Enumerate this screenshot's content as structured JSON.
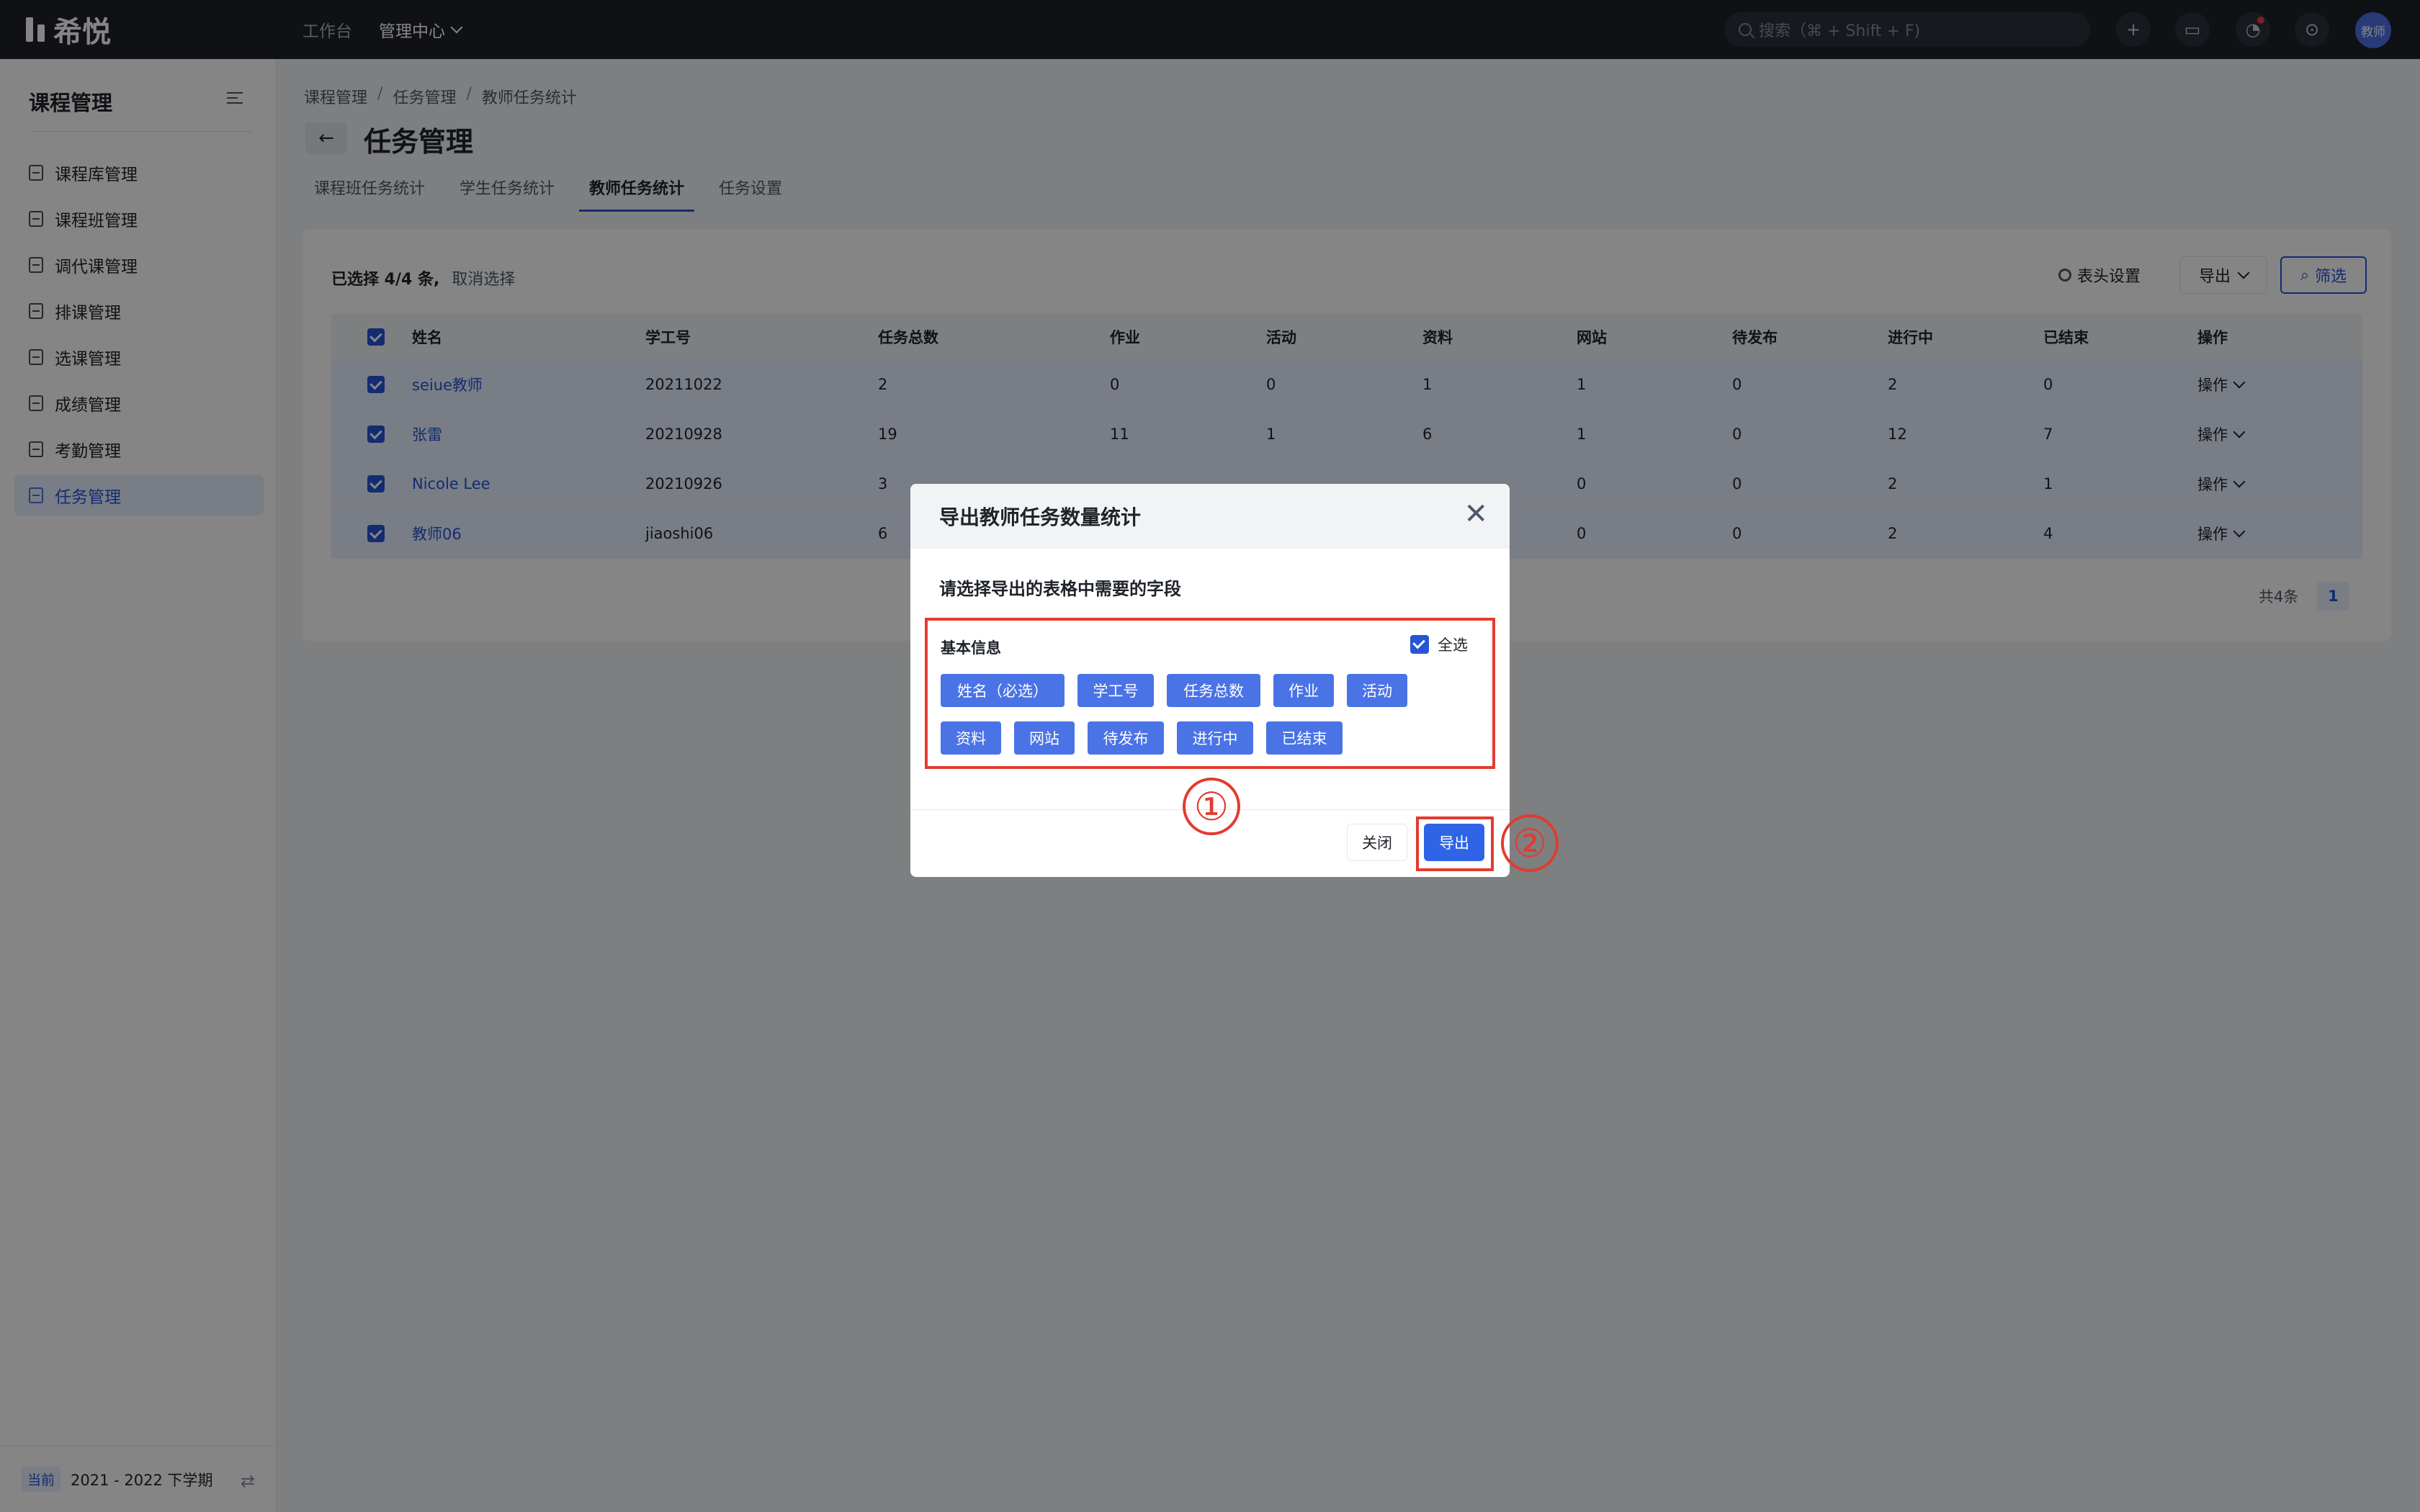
{
  "app": {
    "logo_text": "希悦"
  },
  "topbar": {
    "nav_work": "工作台",
    "nav_mgmt": "管理中心",
    "search_placeholder": "搜索（⌘ + Shift + F)",
    "avatar_text": "教师"
  },
  "sidebar": {
    "title": "课程管理",
    "items": [
      {
        "label": "课程库管理",
        "icon": "course-library-icon"
      },
      {
        "label": "课程班管理",
        "icon": "class-icon"
      },
      {
        "label": "调代课管理",
        "icon": "substitute-icon"
      },
      {
        "label": "排课管理",
        "icon": "schedule-icon"
      },
      {
        "label": "选课管理",
        "icon": "selection-icon"
      },
      {
        "label": "成绩管理",
        "icon": "grade-icon"
      },
      {
        "label": "考勤管理",
        "icon": "attendance-icon"
      },
      {
        "label": "任务管理",
        "icon": "task-list-icon",
        "active": true
      }
    ],
    "footer_badge": "当前",
    "footer_term": "2021 - 2022 下学期"
  },
  "breadcrumb": [
    "课程管理",
    "任务管理",
    "教师任务统计"
  ],
  "page": {
    "title": "任务管理"
  },
  "tabs": [
    "课程班任务统计",
    "学生任务统计",
    "教师任务统计",
    "任务设置"
  ],
  "active_tab": 2,
  "toolbar": {
    "selected_text": "已选择 4/4 条,",
    "cancel_select": "取消选择",
    "header_settings": "表头设置",
    "export_label": "导出",
    "filter_label": "筛选"
  },
  "table": {
    "columns": [
      "姓名",
      "学工号",
      "任务总数",
      "作业",
      "活动",
      "资料",
      "网站",
      "待发布",
      "进行中",
      "已结束",
      "操作"
    ],
    "rows": [
      [
        "seiue教师",
        "20211022",
        "2",
        "0",
        "0",
        "1",
        "1",
        "0",
        "2",
        "0",
        "操作"
      ],
      [
        "张雷",
        "20210928",
        "19",
        "11",
        "1",
        "6",
        "1",
        "0",
        "12",
        "7",
        "操作"
      ],
      [
        "Nicole Lee",
        "20210926",
        "3",
        "",
        "",
        "",
        "0",
        "0",
        "2",
        "1",
        "操作"
      ],
      [
        "教师06",
        "jiaoshi06",
        "6",
        "",
        "",
        "",
        "0",
        "0",
        "2",
        "4",
        "操作"
      ]
    ]
  },
  "pager": {
    "total": "共4条",
    "current": "1"
  },
  "modal": {
    "title": "导出教师任务数量统计",
    "subtitle": "请选择导出的表格中需要的字段",
    "group_label": "基本信息",
    "select_all": "全选",
    "fields": [
      "姓名（必选）",
      "学工号",
      "任务总数",
      "作业",
      "活动",
      "资料",
      "网站",
      "待发布",
      "进行中",
      "已结束"
    ],
    "close_label": "关闭",
    "export_label": "导出"
  },
  "annotations": {
    "marker1": "①",
    "marker2": "②"
  },
  "colors": {
    "accent": "#2655d8",
    "chip": "#4a73e6",
    "highlight": "#e33b2f",
    "topbar": "#1d2129"
  }
}
